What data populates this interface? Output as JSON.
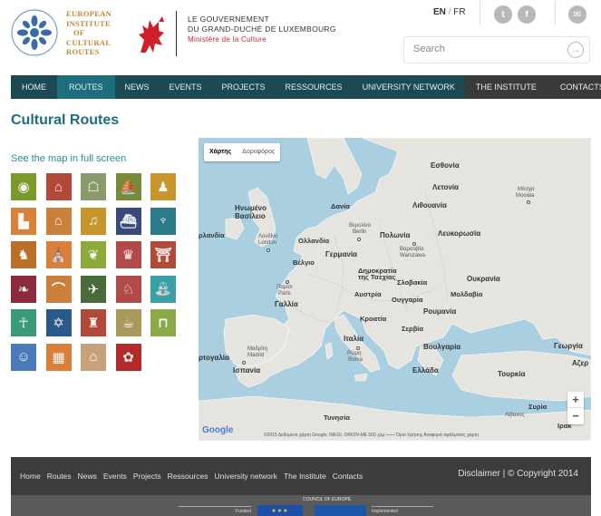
{
  "header": {
    "eicr_lines": [
      "EUROPEAN",
      "INSTITUTE",
      "OF",
      "CULTURAL",
      "ROUTES"
    ],
    "gov_line1": "LE GOUVERNEMENT",
    "gov_line2": "DU GRAND-DUCHÉ DE LUXEMBOURG",
    "gov_line3": "Ministère de la Culture",
    "lang_active": "EN",
    "lang_sep": " / ",
    "lang_other": "FR",
    "social": [
      {
        "name": "twitter-icon",
        "glyph": "t"
      },
      {
        "name": "facebook-icon",
        "glyph": "f"
      },
      {
        "name": "email-icon",
        "glyph": "✉"
      }
    ],
    "search_placeholder": "Search",
    "search_go": "→"
  },
  "nav": {
    "items": [
      {
        "label": "HOME",
        "state": "normal"
      },
      {
        "label": "ROUTES",
        "state": "active"
      },
      {
        "label": "NEWS",
        "state": "normal"
      },
      {
        "label": "EVENTS",
        "state": "normal"
      },
      {
        "label": "PROJECTS",
        "state": "normal"
      },
      {
        "label": "RESSOURCES",
        "state": "normal"
      },
      {
        "label": "UNIVERSITY NETWORK",
        "state": "normal"
      },
      {
        "label": "THE INSTITUTE",
        "state": "dark"
      },
      {
        "label": "CONTACTS",
        "state": "dark"
      }
    ]
  },
  "main": {
    "title": "Cultural Routes",
    "map_link": "See the map in full screen"
  },
  "routes_icons": [
    {
      "name": "shell-route-icon",
      "color": "#7a9a2a"
    },
    {
      "name": "cathedral-route-icon",
      "color": "#b24a3a"
    },
    {
      "name": "viking-route-icon",
      "color": "#8a9a6a"
    },
    {
      "name": "ship-route-icon",
      "color": "#7a8a3a"
    },
    {
      "name": "statue-route-icon",
      "color": "#c8952a"
    },
    {
      "name": "castle-route-icon",
      "color": "#d9803a"
    },
    {
      "name": "monastery-route-icon",
      "color": "#c8803a"
    },
    {
      "name": "mozart-route-icon",
      "color": "#c8952a"
    },
    {
      "name": "boat-route-icon",
      "color": "#3a4a7a"
    },
    {
      "name": "phoenician-route-icon",
      "color": "#2a7a8a"
    },
    {
      "name": "rider-route-icon",
      "color": "#b8702a"
    },
    {
      "name": "church-route-icon",
      "color": "#d9803a"
    },
    {
      "name": "olive-route-icon",
      "color": "#8aaa3a"
    },
    {
      "name": "crown-route-icon",
      "color": "#b24a4a"
    },
    {
      "name": "temple-route-icon",
      "color": "#b24a3a"
    },
    {
      "name": "wine-route-icon",
      "color": "#8a2a3a"
    },
    {
      "name": "arch-route-icon",
      "color": "#c8803a"
    },
    {
      "name": "bird-route-icon",
      "color": "#4a6a3a"
    },
    {
      "name": "animal-route-icon",
      "color": "#b24a4a"
    },
    {
      "name": "fountain-route-icon",
      "color": "#3aa0a8"
    },
    {
      "name": "figure-route-icon",
      "color": "#3a9a7a"
    },
    {
      "name": "menorah-route-icon",
      "color": "#2a5a8a"
    },
    {
      "name": "tower-route-icon",
      "color": "#b24a3a"
    },
    {
      "name": "cup-route-icon",
      "color": "#a89a5a"
    },
    {
      "name": "dolmen-route-icon",
      "color": "#8aaa4a"
    },
    {
      "name": "person-route-icon",
      "color": "#4a7ab8"
    },
    {
      "name": "pattern-route-icon",
      "color": "#d9803a"
    },
    {
      "name": "gothic-route-icon",
      "color": "#c8a07a"
    },
    {
      "name": "flower-route-icon",
      "color": "#b22a2a"
    }
  ],
  "map": {
    "toggle_map": "Χάρτης",
    "toggle_sat": "Δορυφόρος",
    "zoom_in": "+",
    "zoom_out": "−",
    "google": "Google",
    "attribution": "©2015 Δεδομένα χάρτη Google, INEGI, ORION-ME   500 χλμ ⎯⎯⎯⎯   Όροι Χρήσης   Αναφορά σφάλματος χάρτη",
    "labels": [
      {
        "text": "Εσθονία",
        "cls": "big"
      },
      {
        "text": "Λετονία",
        "cls": "big"
      },
      {
        "text": "Λιθουανία",
        "cls": "big"
      },
      {
        "text": "Μόσχα",
        "cls": "small"
      },
      {
        "text": "Москва",
        "cls": "small"
      },
      {
        "text": "Ηνωμένο",
        "cls": "big"
      },
      {
        "text": "Βασίλειο",
        "cls": "big"
      },
      {
        "text": "Δανία",
        "cls": ""
      },
      {
        "text": "ρλανδία",
        "cls": ""
      },
      {
        "text": "Λονδίνο",
        "cls": "small"
      },
      {
        "text": "London",
        "cls": "small"
      },
      {
        "text": "Ολλανδία",
        "cls": ""
      },
      {
        "text": "Βερολίνο",
        "cls": "small"
      },
      {
        "text": "Berlin",
        "cls": "small"
      },
      {
        "text": "Πολωνία",
        "cls": "big"
      },
      {
        "text": "Βαρσοβία",
        "cls": "small"
      },
      {
        "text": "Warszawa",
        "cls": "small"
      },
      {
        "text": "Λευκορωσία",
        "cls": "big"
      },
      {
        "text": "Βέλγιο",
        "cls": ""
      },
      {
        "text": "Γερμανία",
        "cls": "big"
      },
      {
        "text": "Δημοκρατία",
        "cls": ""
      },
      {
        "text": "της Τσεχίας",
        "cls": ""
      },
      {
        "text": "Σλοβακία",
        "cls": ""
      },
      {
        "text": "Ουκρανία",
        "cls": "big"
      },
      {
        "text": "Παρίσι",
        "cls": "small"
      },
      {
        "text": "Paris",
        "cls": "small"
      },
      {
        "text": "Γαλλία",
        "cls": "big"
      },
      {
        "text": "Αυστρία",
        "cls": ""
      },
      {
        "text": "Ουγγαρία",
        "cls": ""
      },
      {
        "text": "Μολδαβία",
        "cls": ""
      },
      {
        "text": "Ρουμανία",
        "cls": "big"
      },
      {
        "text": "Κροατία",
        "cls": ""
      },
      {
        "text": "Σερβία",
        "cls": ""
      },
      {
        "text": "Ιταλία",
        "cls": "big"
      },
      {
        "text": "Μαδρίτη",
        "cls": "small"
      },
      {
        "text": "Madrid",
        "cls": "small"
      },
      {
        "text": "ρτογαλία",
        "cls": "big"
      },
      {
        "text": "Ισπανία",
        "cls": "big"
      },
      {
        "text": "Ρώμη",
        "cls": "small"
      },
      {
        "text": "Roma",
        "cls": "small"
      },
      {
        "text": "Βουλγαρία",
        "cls": "big"
      },
      {
        "text": "Γεωργία",
        "cls": "big"
      },
      {
        "text": "Αζερ",
        "cls": "big"
      },
      {
        "text": "Ελλάδα",
        "cls": "big"
      },
      {
        "text": "Τουρκία",
        "cls": "big"
      },
      {
        "text": "Τυνησία",
        "cls": ""
      },
      {
        "text": "Συρία",
        "cls": ""
      },
      {
        "text": "Λίβανος",
        "cls": "small"
      },
      {
        "text": "Ιρακ",
        "cls": ""
      }
    ]
  },
  "footer": {
    "links": [
      "Home",
      "Routes",
      "News",
      "Events",
      "Projects",
      "Ressources",
      "University network",
      "The Institute",
      "Contacts"
    ],
    "right": "Disclaimer | © Copyright 2014",
    "funded": "Funded",
    "coe_label": "COUNCIL OF EUROPE",
    "implemented": "Implemented",
    "eu_flag": "★★★"
  }
}
